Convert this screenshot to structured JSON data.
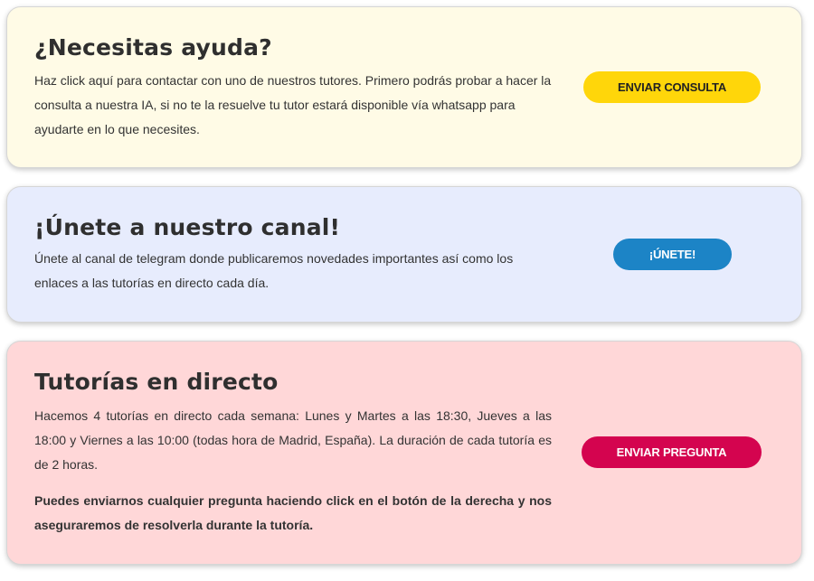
{
  "colors": {
    "help_bg": "#fffbe6",
    "channel_bg": "#e7ecfd",
    "live_bg": "#ffd7d8",
    "consulta_button": "#ffd60a",
    "unete_button": "#1c84c6",
    "pregunta_button": "#d4044f"
  },
  "help": {
    "title": "¿Necesitas ayuda?",
    "text": "Haz click aquí para contactar con uno de nuestros tutores. Primero podrás probar a hacer la consulta a nuestra IA, si no te la resuelve tu tutor estará disponible vía whatsapp para ayudarte en lo que necesites.",
    "button_label": "ENVIAR CONSULTA"
  },
  "channel": {
    "title": "¡Únete a nuestro canal!",
    "text": "Únete al canal de telegram donde publicaremos novedades importantes así como los enlaces a las tutorías en directo cada día.",
    "button_label": "¡ÚNETE!"
  },
  "live": {
    "title": "Tutorías en directo",
    "text": "Hacemos 4 tutorías en directo cada semana: Lunes y Martes a las 18:30, Jueves a las 18:00 y Viernes a las 10:00 (todas hora de Madrid, España). La duración de cada tutoría es de 2 horas.",
    "note": "Puedes enviarnos cualquier pregunta haciendo click en el botón de la derecha y nos aseguraremos de resolverla durante la tutoría.",
    "button_label": "ENVIAR PREGUNTA"
  }
}
